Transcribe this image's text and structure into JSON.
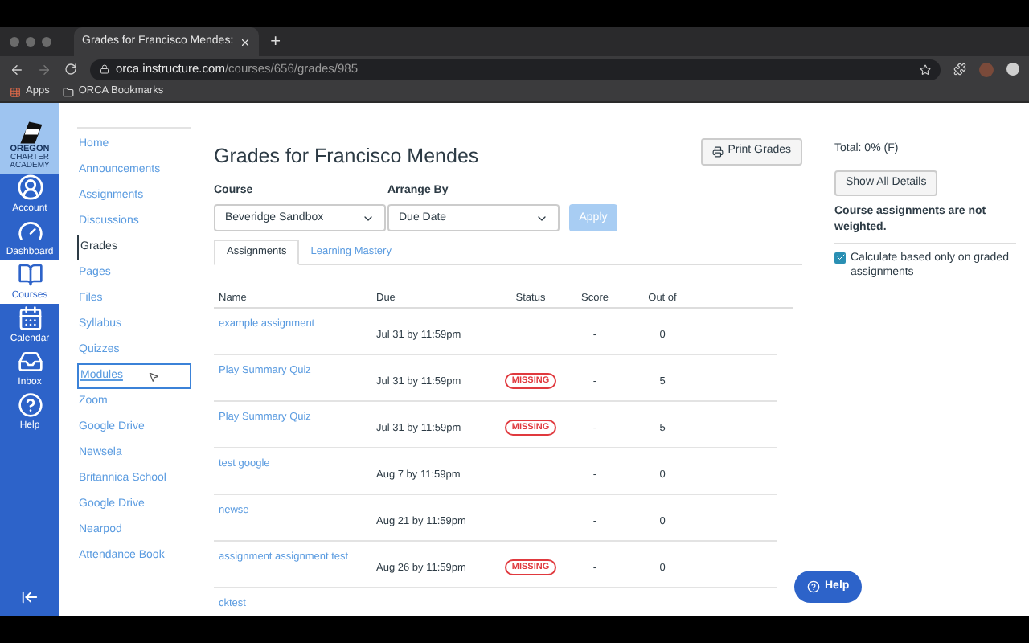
{
  "browser": {
    "tab_title": "Grades for Francisco Mendes:",
    "new_tab": "+",
    "url_host": "orca.instructure.com",
    "url_path": "/courses/656/grades/985",
    "bookmarks": [
      "Apps",
      "ORCA Bookmarks"
    ]
  },
  "logo": {
    "line1": "OREGON",
    "line2": "CHARTER ACADEMY"
  },
  "global_nav": [
    {
      "kind": "account",
      "label": "Account",
      "selected": false
    },
    {
      "kind": "dashboard",
      "label": "Dashboard",
      "selected": false
    },
    {
      "kind": "courses",
      "label": "Courses",
      "selected": true
    },
    {
      "kind": "calendar",
      "label": "Calendar",
      "selected": false
    },
    {
      "kind": "inbox",
      "label": "Inbox",
      "selected": false
    },
    {
      "kind": "help",
      "label": "Help",
      "selected": false
    }
  ],
  "course_nav": [
    {
      "label": "Home",
      "selected": false,
      "focused": false
    },
    {
      "label": "Announcements",
      "selected": false,
      "focused": false
    },
    {
      "label": "Assignments",
      "selected": false,
      "focused": false
    },
    {
      "label": "Discussions",
      "selected": false,
      "focused": false
    },
    {
      "label": "Grades",
      "selected": true,
      "focused": false
    },
    {
      "label": "Pages",
      "selected": false,
      "focused": false
    },
    {
      "label": "Files",
      "selected": false,
      "focused": false
    },
    {
      "label": "Syllabus",
      "selected": false,
      "focused": false
    },
    {
      "label": "Quizzes",
      "selected": false,
      "focused": false
    },
    {
      "label": "Modules",
      "selected": false,
      "focused": true
    },
    {
      "label": "Zoom",
      "selected": false,
      "focused": false
    },
    {
      "label": "Google Drive",
      "selected": false,
      "focused": false
    },
    {
      "label": "Newsela",
      "selected": false,
      "focused": false
    },
    {
      "label": "Britannica School",
      "selected": false,
      "focused": false
    },
    {
      "label": "Google Drive",
      "selected": false,
      "focused": false
    },
    {
      "label": "Nearpod",
      "selected": false,
      "focused": false
    },
    {
      "label": "Attendance Book",
      "selected": false,
      "focused": false
    }
  ],
  "title": "Grades for Francisco Mendes",
  "print_button": "Print Grades",
  "filters": {
    "course_label": "Course",
    "course_value": "Beveridge Sandbox",
    "arrange_label": "Arrange By",
    "arrange_value": "Due Date",
    "apply": "Apply",
    "apply_disabled": true
  },
  "tabs": [
    {
      "label": "Assignments",
      "selected": true
    },
    {
      "label": "Learning Mastery",
      "selected": false
    }
  ],
  "table": {
    "columns": [
      "Name",
      "Due",
      "Status",
      "Score",
      "Out of"
    ],
    "rows": [
      {
        "name": "example assignment",
        "due": "Jul 31 by 11:59pm",
        "score": "-",
        "out_of": "0"
      },
      {
        "name": "Play Summary Quiz",
        "due": "Jul 31 by 11:59pm",
        "status": "MISSING",
        "score": "-",
        "out_of": "5"
      },
      {
        "name": "Play Summary Quiz",
        "due": "Jul 31 by 11:59pm",
        "status": "MISSING",
        "score": "-",
        "out_of": "5"
      },
      {
        "name": "test google",
        "due": "Aug 7 by 11:59pm",
        "score": "-",
        "out_of": "0"
      },
      {
        "name": "newse",
        "due": "Aug 21 by 11:59pm",
        "score": "-",
        "out_of": "0"
      },
      {
        "name": "assignment assignment test",
        "due": "Aug 26 by 11:59pm",
        "status": "MISSING",
        "score": "-",
        "out_of": "0"
      },
      {
        "name": "cktest"
      }
    ]
  },
  "sidebar": {
    "total": "Total: 0% (F)",
    "show_details": "Show All Details",
    "weight_note": "Course assignments are not weighted.",
    "calc_label": "Calculate based only on graded assignments",
    "calc_checked": true
  },
  "help_button": "Help"
}
